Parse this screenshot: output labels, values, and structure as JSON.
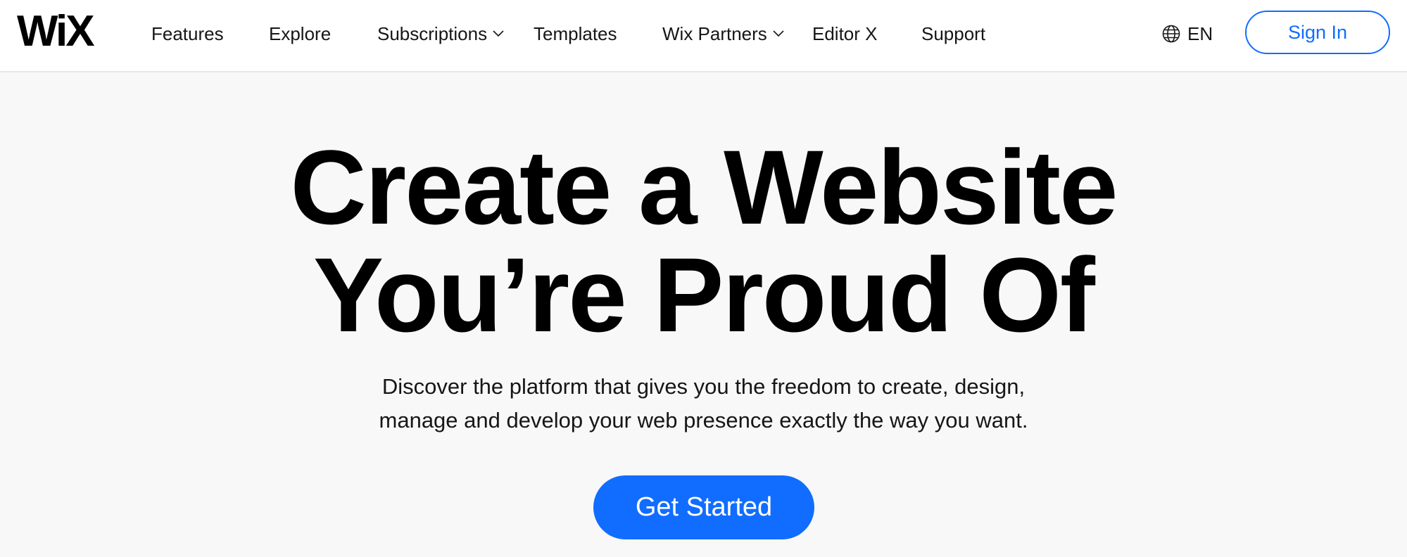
{
  "brand": {
    "logo": "WiX",
    "accent_color": "#116dff"
  },
  "nav": {
    "items": [
      {
        "label": "Features",
        "has_dropdown": false
      },
      {
        "label": "Explore",
        "has_dropdown": false
      },
      {
        "label": "Subscriptions",
        "has_dropdown": true
      },
      {
        "label": "Templates",
        "has_dropdown": false
      },
      {
        "label": "Wix Partners",
        "has_dropdown": true
      },
      {
        "label": "Editor X",
        "has_dropdown": false
      },
      {
        "label": "Support",
        "has_dropdown": false
      }
    ],
    "language": {
      "icon": "globe-icon",
      "label": "EN"
    },
    "signin_label": "Sign In"
  },
  "hero": {
    "title_line1": "Create a Website",
    "title_line2": "You’re Proud Of",
    "subtitle_line1": "Discover the platform that gives you the freedom to create, design,",
    "subtitle_line2": "manage and develop your web presence exactly the way you want.",
    "cta_label": "Get Started"
  }
}
